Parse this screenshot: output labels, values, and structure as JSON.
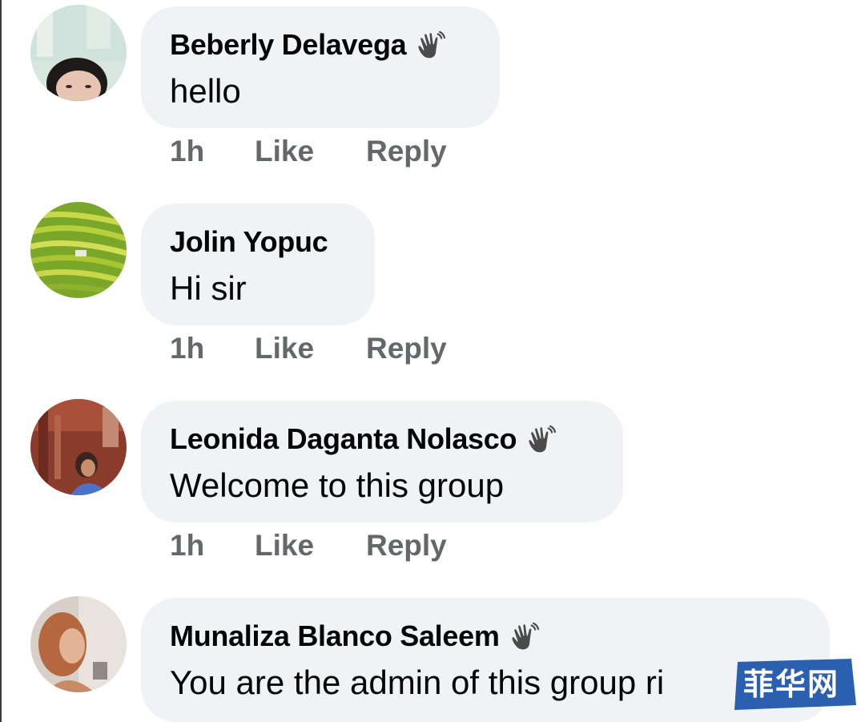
{
  "comments": [
    {
      "author": "Beberly Delavega",
      "badge_icon": "wave-icon",
      "text": "hello",
      "time": "1h",
      "like_label": "Like",
      "reply_label": "Reply"
    },
    {
      "author": "Jolin Yopuc",
      "badge_icon": "",
      "text": "Hi sir",
      "time": "1h",
      "like_label": "Like",
      "reply_label": "Reply"
    },
    {
      "author": "Leonida Daganta Nolasco",
      "badge_icon": "wave-icon",
      "text": "Welcome to this group",
      "time": "1h",
      "like_label": "Like",
      "reply_label": "Reply"
    },
    {
      "author": "Munaliza Blanco Saleem",
      "badge_icon": "wave-icon",
      "text": "You are the admin of this group ri",
      "time": "",
      "like_label": "",
      "reply_label": ""
    }
  ],
  "watermark": {
    "text": "菲华网",
    "color": "#2b5fb0"
  },
  "colors": {
    "bubble": "#f0f2f5",
    "meta": "#65676b",
    "icon": "#4b4b4b"
  }
}
